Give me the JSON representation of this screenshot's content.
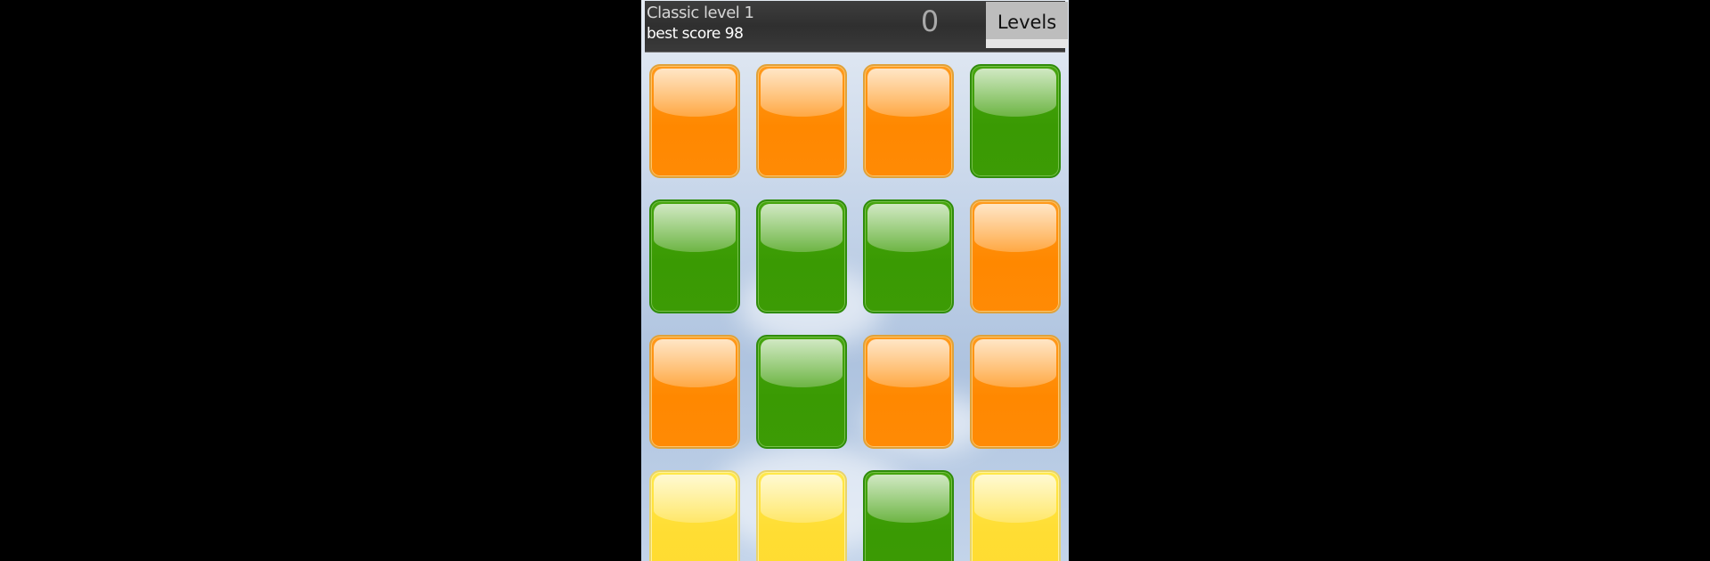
{
  "header": {
    "level_title": "Classic level 1",
    "best_score_text": "best score 98",
    "score": "0",
    "levels_button_label": "Levels"
  },
  "colors": {
    "orange": "#ff8800",
    "green": "#3a9a03",
    "yellow": "#ffdd33",
    "header_background": "#333333",
    "levels_button": "#bdbdbd"
  },
  "board": {
    "columns": 4,
    "rows": [
      [
        "orange",
        "orange",
        "orange",
        "green"
      ],
      [
        "green",
        "green",
        "green",
        "orange"
      ],
      [
        "orange",
        "green",
        "orange",
        "orange"
      ],
      [
        "yellow",
        "yellow",
        "green",
        "yellow"
      ]
    ]
  }
}
